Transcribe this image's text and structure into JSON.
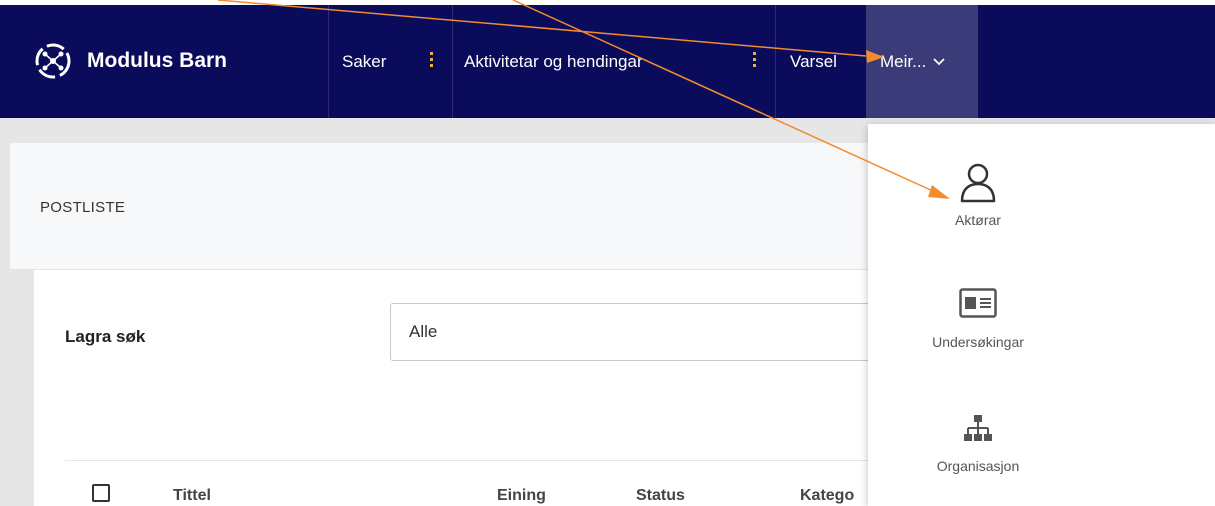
{
  "brand": {
    "name": "Modulus Barn",
    "logo": "modulus-logo-icon"
  },
  "nav": {
    "items": [
      {
        "label": "Saker"
      },
      {
        "label": "Aktivitetar og hendingar"
      },
      {
        "label": "Varsel"
      }
    ],
    "more_label": "Meir...",
    "more_icon": "chevron-down-icon"
  },
  "panel": {
    "title": "POSTLISTE"
  },
  "search": {
    "label": "Lagra søk",
    "value": "Alle"
  },
  "table": {
    "columns": [
      "Tittel",
      "Eining",
      "Status",
      "Katego"
    ]
  },
  "dropdown": {
    "items": [
      {
        "label": "Aktørar",
        "icon": "user-icon"
      },
      {
        "label": "Undersøkingar",
        "icon": "id-card-icon"
      },
      {
        "label": "Organisasjon",
        "icon": "org-chart-icon"
      }
    ]
  },
  "colors": {
    "topbar": "#0b0b5c",
    "more_active": "#3b3b7a",
    "annotation": "#f28a2e",
    "kebab": "#e8b23a"
  }
}
